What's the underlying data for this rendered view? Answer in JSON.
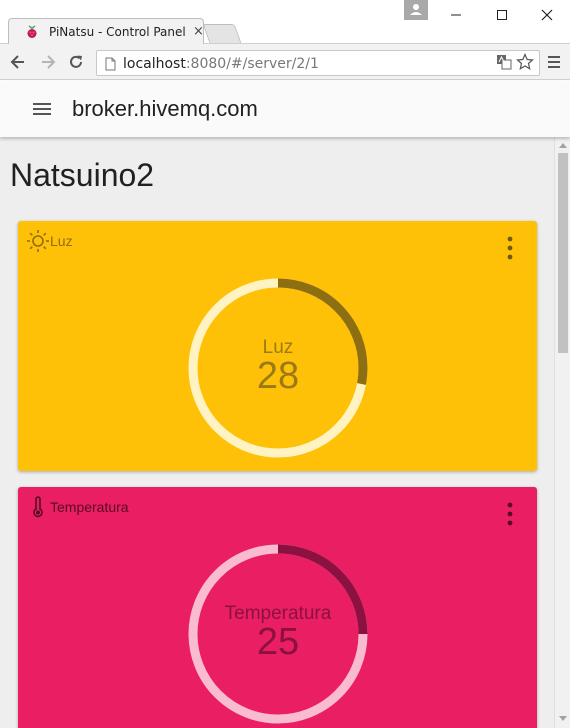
{
  "browser": {
    "tab_title": "PiNatsu - Control Panel",
    "tab_close": "×",
    "url_host": "localhost",
    "url_path": ":8080/#/server/2/1"
  },
  "app": {
    "toolbar_title": "broker.hivemq.com",
    "page_title": "Natsuino2"
  },
  "cards": [
    {
      "label": "Luz",
      "icon": "sun-icon",
      "gauge_label": "Luz",
      "value": "28",
      "fill_fraction": 0.28,
      "color": "#ffc107",
      "arc_color": "#8d6e10",
      "track_color": "#fff3c4",
      "text_color": "#9b7a16"
    },
    {
      "label": "Temperatura",
      "icon": "thermometer-icon",
      "gauge_label": "Temperatura",
      "value": "25",
      "fill_fraction": 0.25,
      "color": "#e91e63",
      "arc_color": "#8c1140",
      "track_color": "#f8bbd0",
      "text_color": "#8c1140"
    }
  ]
}
